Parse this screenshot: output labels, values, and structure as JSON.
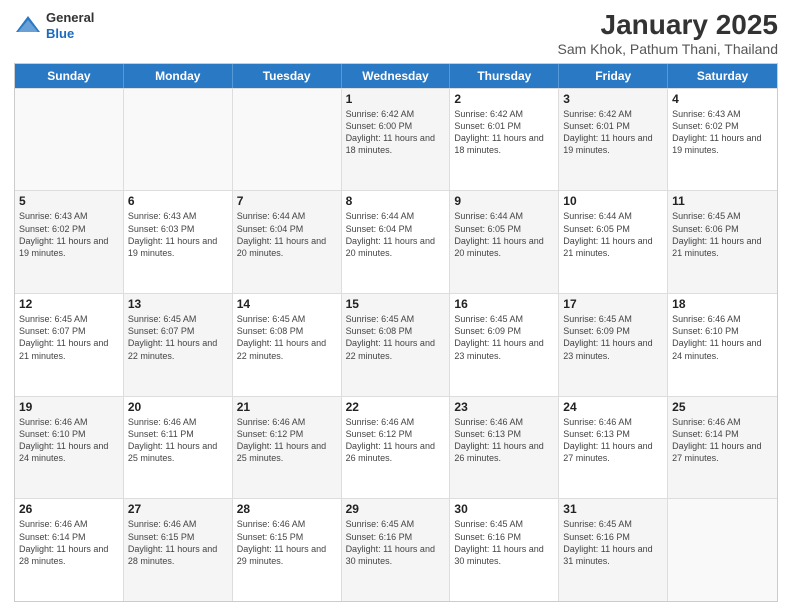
{
  "header": {
    "logo_general": "General",
    "logo_blue": "Blue",
    "title": "January 2025",
    "subtitle": "Sam Khok, Pathum Thani, Thailand"
  },
  "days_of_week": [
    "Sunday",
    "Monday",
    "Tuesday",
    "Wednesday",
    "Thursday",
    "Friday",
    "Saturday"
  ],
  "weeks": [
    [
      {
        "day": "",
        "info": "",
        "empty": true
      },
      {
        "day": "",
        "info": "",
        "empty": true
      },
      {
        "day": "",
        "info": "",
        "empty": true
      },
      {
        "day": "1",
        "info": "Sunrise: 6:42 AM\nSunset: 6:00 PM\nDaylight: 11 hours and 18 minutes.",
        "shaded": true
      },
      {
        "day": "2",
        "info": "Sunrise: 6:42 AM\nSunset: 6:01 PM\nDaylight: 11 hours and 18 minutes."
      },
      {
        "day": "3",
        "info": "Sunrise: 6:42 AM\nSunset: 6:01 PM\nDaylight: 11 hours and 19 minutes.",
        "shaded": true
      },
      {
        "day": "4",
        "info": "Sunrise: 6:43 AM\nSunset: 6:02 PM\nDaylight: 11 hours and 19 minutes."
      }
    ],
    [
      {
        "day": "5",
        "info": "Sunrise: 6:43 AM\nSunset: 6:02 PM\nDaylight: 11 hours and 19 minutes.",
        "shaded": true
      },
      {
        "day": "6",
        "info": "Sunrise: 6:43 AM\nSunset: 6:03 PM\nDaylight: 11 hours and 19 minutes."
      },
      {
        "day": "7",
        "info": "Sunrise: 6:44 AM\nSunset: 6:04 PM\nDaylight: 11 hours and 20 minutes.",
        "shaded": true
      },
      {
        "day": "8",
        "info": "Sunrise: 6:44 AM\nSunset: 6:04 PM\nDaylight: 11 hours and 20 minutes."
      },
      {
        "day": "9",
        "info": "Sunrise: 6:44 AM\nSunset: 6:05 PM\nDaylight: 11 hours and 20 minutes.",
        "shaded": true
      },
      {
        "day": "10",
        "info": "Sunrise: 6:44 AM\nSunset: 6:05 PM\nDaylight: 11 hours and 21 minutes."
      },
      {
        "day": "11",
        "info": "Sunrise: 6:45 AM\nSunset: 6:06 PM\nDaylight: 11 hours and 21 minutes.",
        "shaded": true
      }
    ],
    [
      {
        "day": "12",
        "info": "Sunrise: 6:45 AM\nSunset: 6:07 PM\nDaylight: 11 hours and 21 minutes."
      },
      {
        "day": "13",
        "info": "Sunrise: 6:45 AM\nSunset: 6:07 PM\nDaylight: 11 hours and 22 minutes.",
        "shaded": true
      },
      {
        "day": "14",
        "info": "Sunrise: 6:45 AM\nSunset: 6:08 PM\nDaylight: 11 hours and 22 minutes."
      },
      {
        "day": "15",
        "info": "Sunrise: 6:45 AM\nSunset: 6:08 PM\nDaylight: 11 hours and 22 minutes.",
        "shaded": true
      },
      {
        "day": "16",
        "info": "Sunrise: 6:45 AM\nSunset: 6:09 PM\nDaylight: 11 hours and 23 minutes."
      },
      {
        "day": "17",
        "info": "Sunrise: 6:45 AM\nSunset: 6:09 PM\nDaylight: 11 hours and 23 minutes.",
        "shaded": true
      },
      {
        "day": "18",
        "info": "Sunrise: 6:46 AM\nSunset: 6:10 PM\nDaylight: 11 hours and 24 minutes."
      }
    ],
    [
      {
        "day": "19",
        "info": "Sunrise: 6:46 AM\nSunset: 6:10 PM\nDaylight: 11 hours and 24 minutes.",
        "shaded": true
      },
      {
        "day": "20",
        "info": "Sunrise: 6:46 AM\nSunset: 6:11 PM\nDaylight: 11 hours and 25 minutes."
      },
      {
        "day": "21",
        "info": "Sunrise: 6:46 AM\nSunset: 6:12 PM\nDaylight: 11 hours and 25 minutes.",
        "shaded": true
      },
      {
        "day": "22",
        "info": "Sunrise: 6:46 AM\nSunset: 6:12 PM\nDaylight: 11 hours and 26 minutes."
      },
      {
        "day": "23",
        "info": "Sunrise: 6:46 AM\nSunset: 6:13 PM\nDaylight: 11 hours and 26 minutes.",
        "shaded": true
      },
      {
        "day": "24",
        "info": "Sunrise: 6:46 AM\nSunset: 6:13 PM\nDaylight: 11 hours and 27 minutes."
      },
      {
        "day": "25",
        "info": "Sunrise: 6:46 AM\nSunset: 6:14 PM\nDaylight: 11 hours and 27 minutes.",
        "shaded": true
      }
    ],
    [
      {
        "day": "26",
        "info": "Sunrise: 6:46 AM\nSunset: 6:14 PM\nDaylight: 11 hours and 28 minutes."
      },
      {
        "day": "27",
        "info": "Sunrise: 6:46 AM\nSunset: 6:15 PM\nDaylight: 11 hours and 28 minutes.",
        "shaded": true
      },
      {
        "day": "28",
        "info": "Sunrise: 6:46 AM\nSunset: 6:15 PM\nDaylight: 11 hours and 29 minutes."
      },
      {
        "day": "29",
        "info": "Sunrise: 6:45 AM\nSunset: 6:16 PM\nDaylight: 11 hours and 30 minutes.",
        "shaded": true
      },
      {
        "day": "30",
        "info": "Sunrise: 6:45 AM\nSunset: 6:16 PM\nDaylight: 11 hours and 30 minutes."
      },
      {
        "day": "31",
        "info": "Sunrise: 6:45 AM\nSunset: 6:16 PM\nDaylight: 11 hours and 31 minutes.",
        "shaded": true
      },
      {
        "day": "",
        "info": "",
        "empty": true
      }
    ]
  ]
}
